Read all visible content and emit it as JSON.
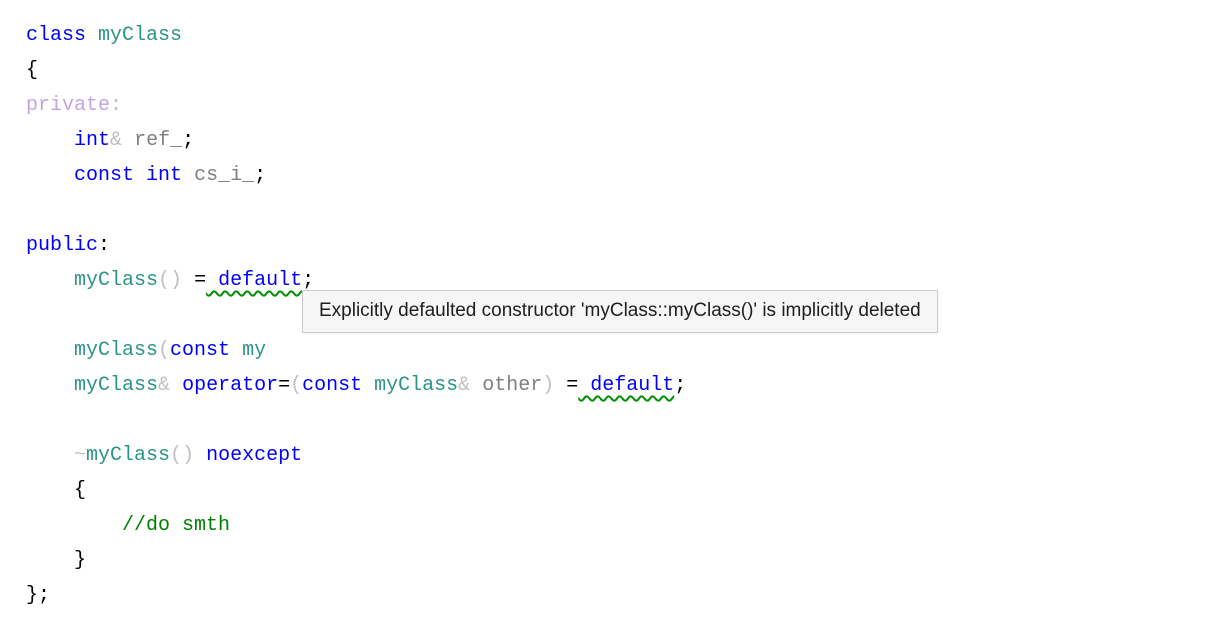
{
  "code": {
    "kw_class": "class",
    "classname": "myClass",
    "brace_open": "{",
    "kw_private": "private",
    "colon": ":",
    "kw_int": "int",
    "amp": "&",
    "ref_name": "ref_",
    "semi": ";",
    "kw_const": "const",
    "csi_name": "cs_i_",
    "kw_public": "public",
    "paren_open": "(",
    "paren_close": ")",
    "eq": "=",
    "kw_default": "default",
    "hidden_kw_const": "const",
    "hidden_my": "my",
    "kw_operator": "operator",
    "assign_op": "=",
    "param_other": "other",
    "tilde": "~",
    "kw_noexcept": "noexcept",
    "brace_open2": "{",
    "comment": "//do smth",
    "brace_close2": "}",
    "brace_close": "}",
    "sp_default_1": " default",
    "sp_default_2": " default"
  },
  "tooltip": {
    "text": "Explicitly defaulted constructor 'myClass::myClass()' is implicitly deleted"
  }
}
